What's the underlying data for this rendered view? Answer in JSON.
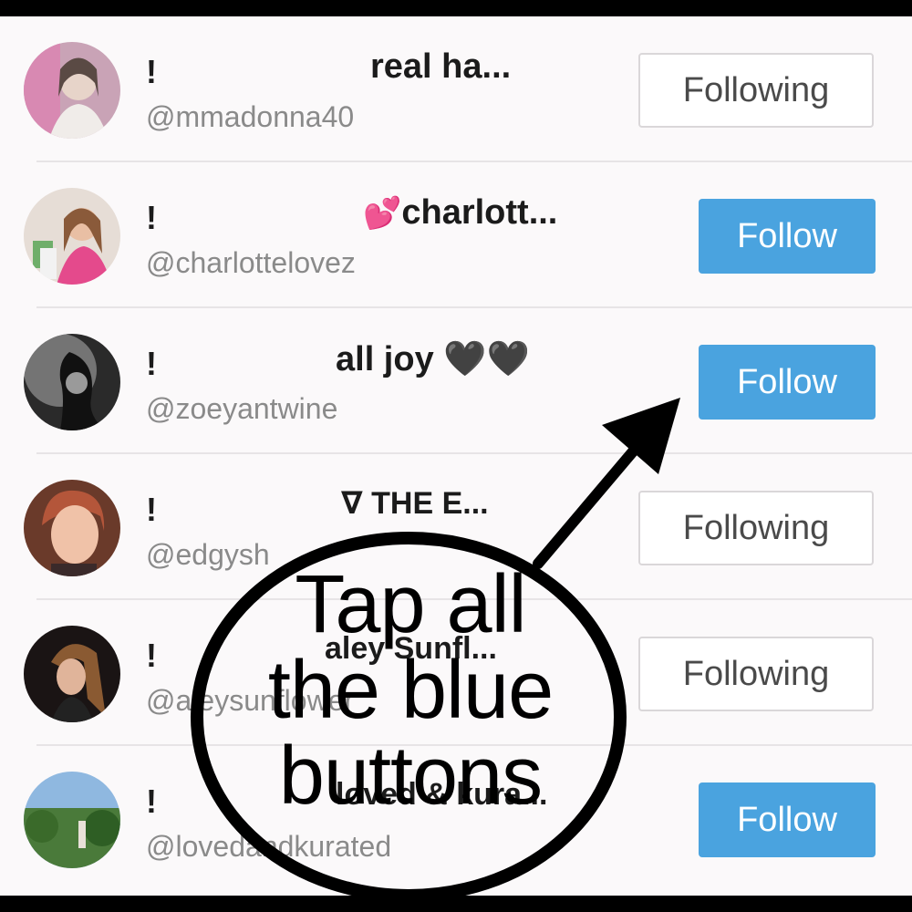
{
  "rows": [
    {
      "bang": "!",
      "name": "real ha...",
      "handle": "@mmadonna40",
      "button": "Following",
      "state": "following"
    },
    {
      "bang": "!",
      "name": "charlott...",
      "name_emoji": "💕",
      "handle": "@charlottelovez",
      "button": "Follow",
      "state": "follow"
    },
    {
      "bang": "!",
      "name": "all joy",
      "name_emoji": "🖤🖤",
      "handle": "@zoeyantwine",
      "button": "Follow",
      "state": "follow"
    },
    {
      "bang": "!",
      "name": "THE E...",
      "name_prefix": "∇",
      "handle": "@edgysh",
      "button": "Following",
      "state": "following"
    },
    {
      "bang": "!",
      "name": "aley Sunfl...",
      "handle": "@aleysunflower",
      "button": "Following",
      "state": "following"
    },
    {
      "bang": "!",
      "name": "loved & kura...",
      "handle": "@lovedandkurated",
      "button": "Follow",
      "state": "follow"
    }
  ],
  "overlay": {
    "text_line1": "Tap all",
    "text_line2": "the blue",
    "text_line3": "buttons"
  },
  "colors": {
    "follow_blue": "#4aa3df",
    "background": "#fbf9fa",
    "handle_gray": "#8a8a8a"
  },
  "icons": [
    "profile-avatar",
    "heart-emoji",
    "arrow-annotation",
    "circle-annotation"
  ]
}
